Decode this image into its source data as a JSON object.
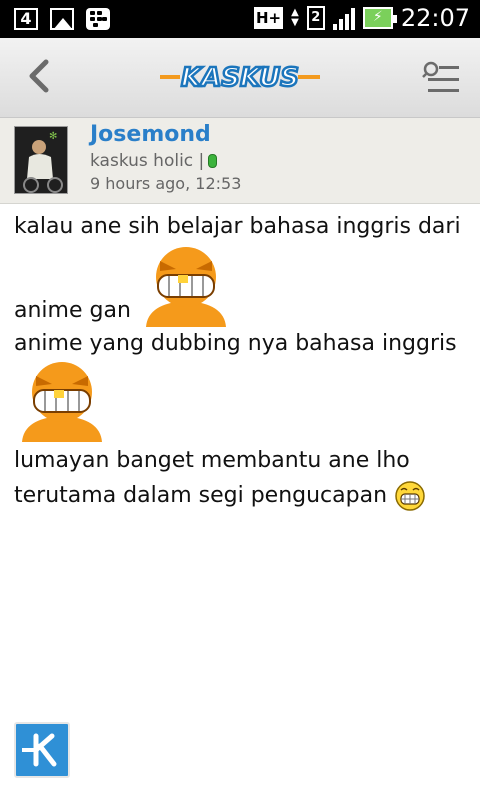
{
  "status_bar": {
    "notification_number": "4",
    "sim_slot": "2",
    "network_type": "H+",
    "time": "22:07"
  },
  "app_bar": {
    "logo_text": "KASKUS"
  },
  "post": {
    "username": "Josemond",
    "rank": "kaskus holic |",
    "timestamp": "9 hours ago, 12:53",
    "lines": {
      "l1": "kalau ane sih belajar bahasa inggris dari",
      "l2": "anime gan",
      "l3": "anime yang dubbing nya bahasa inggris",
      "l4": "lumayan banget membantu ane lho",
      "l5": "terutama dalam segi pengucapan"
    }
  },
  "colors": {
    "accent_blue": "#2a7fc9",
    "logo_orange": "#f39a1e",
    "online_green": "#3cb33c",
    "fab_blue": "#2f90d6"
  }
}
